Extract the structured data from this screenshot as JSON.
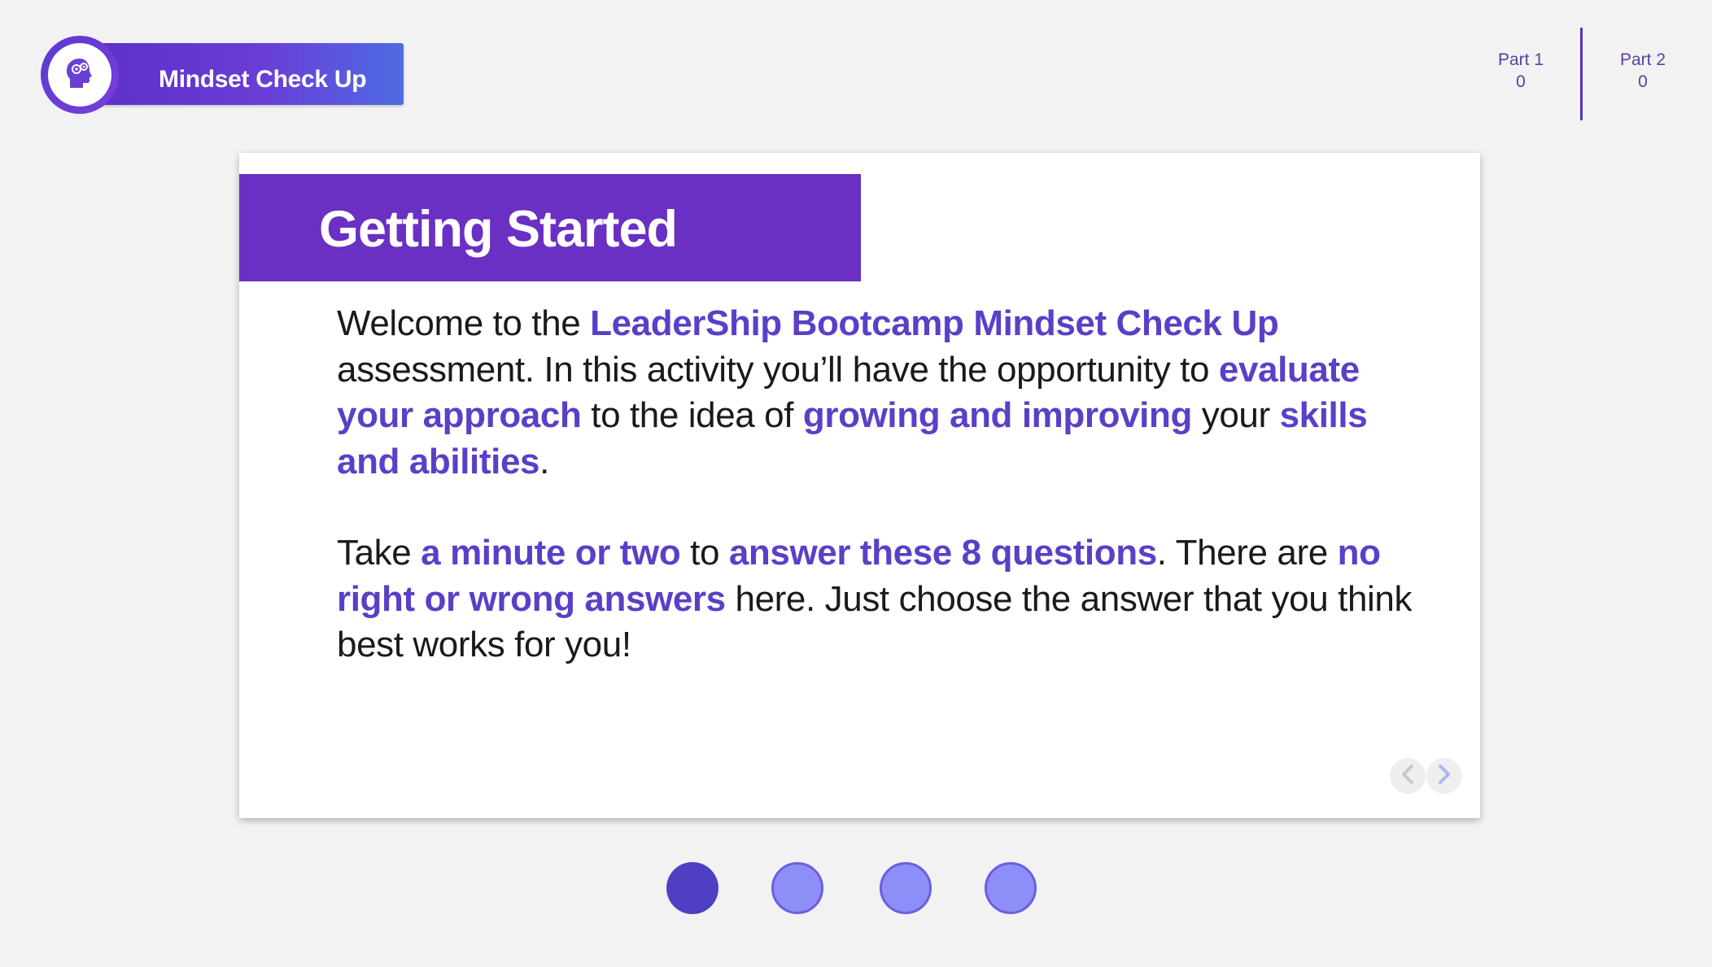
{
  "header": {
    "badge_title": "Mindset Check Up",
    "badge_icon": "head-gears-icon"
  },
  "parts": [
    {
      "label": "Part 1",
      "score": "0"
    },
    {
      "label": "Part 2",
      "score": "0"
    }
  ],
  "card": {
    "title": "Getting Started",
    "paragraph1": [
      {
        "text": "Welcome to the ",
        "highlight": false
      },
      {
        "text": "LeaderShip Bootcamp Mindset Check Up",
        "highlight": true
      },
      {
        "text": " assessment. In this activity you’ll have the opportunity to ",
        "highlight": false
      },
      {
        "text": "evaluate your approach",
        "highlight": true
      },
      {
        "text": " to the idea of ",
        "highlight": false
      },
      {
        "text": "growing and improving",
        "highlight": true
      },
      {
        "text": " your ",
        "highlight": false
      },
      {
        "text": "skills and abilities",
        "highlight": true
      },
      {
        "text": ".",
        "highlight": false
      }
    ],
    "paragraph2": [
      {
        "text": "Take ",
        "highlight": false
      },
      {
        "text": "a minute or two",
        "highlight": true
      },
      {
        "text": " to ",
        "highlight": false
      },
      {
        "text": "answer these 8 questions",
        "highlight": true
      },
      {
        "text": ". There are ",
        "highlight": false
      },
      {
        "text": "no right or wrong answers",
        "highlight": true
      },
      {
        "text": " here. Just choose the answer that you think best works for you!",
        "highlight": false
      }
    ],
    "nav": {
      "prev_icon": "chevron-left-icon",
      "next_icon": "chevron-right-icon"
    }
  },
  "pagination": {
    "total": 4,
    "current": 1
  },
  "colors": {
    "accent": "#6930c3",
    "highlight_text": "#5a3fc8",
    "dot_active": "#4f3fc2",
    "dot_inactive": "#8e8ef8",
    "background": "#f2f2f2"
  }
}
